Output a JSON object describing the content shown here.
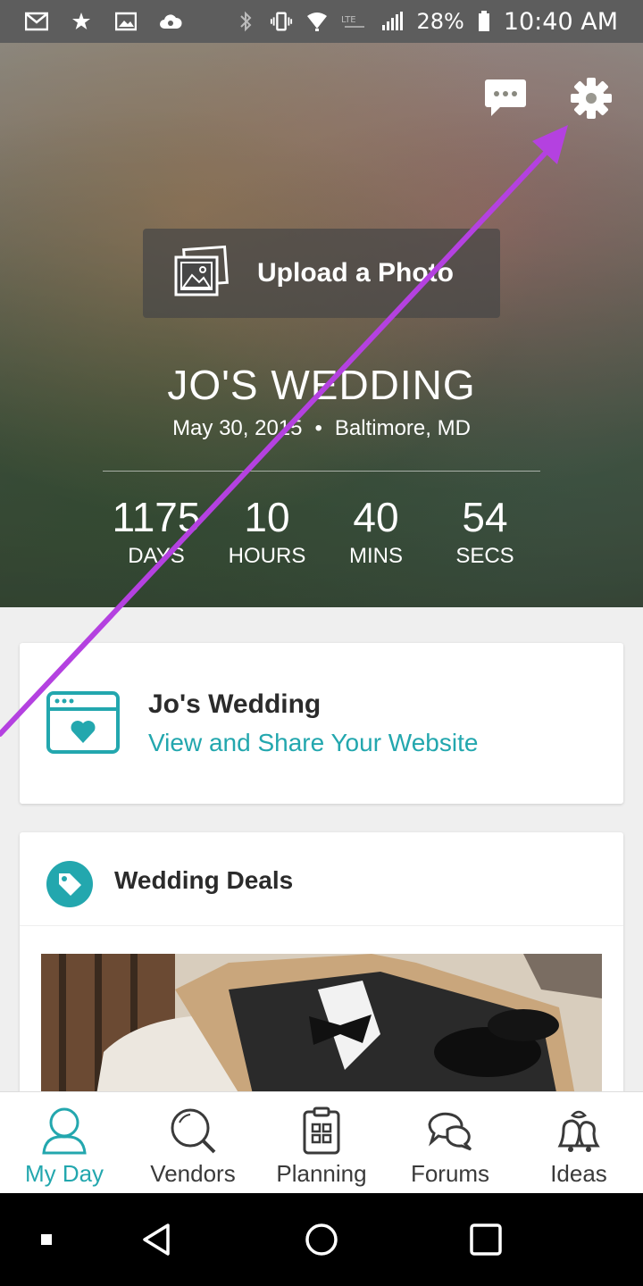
{
  "status_bar": {
    "battery": "28%",
    "time": "10:40 AM",
    "icons": [
      "gmail-icon",
      "star-icon",
      "image-icon",
      "cloud-icon",
      "bluetooth-icon",
      "vibrate-icon",
      "wifi-icon",
      "lte-icon",
      "signal-icon",
      "battery-icon"
    ]
  },
  "hero": {
    "upload_label": "Upload a Photo",
    "wedding_name": "JO'S WEDDING",
    "date": "May 30, 2015",
    "separator": "•",
    "location": "Baltimore, MD",
    "countdown": [
      {
        "value": "1175",
        "unit": "DAYS"
      },
      {
        "value": "10",
        "unit": "HOURS"
      },
      {
        "value": "40",
        "unit": "MINS"
      },
      {
        "value": "54",
        "unit": "SECS"
      }
    ]
  },
  "website_card": {
    "title": "Jo's Wedding",
    "link": "View and Share Your Website"
  },
  "deals_card": {
    "title": "Wedding Deals"
  },
  "bottom_nav": [
    {
      "label": "My Day",
      "icon": "person-icon",
      "active": true
    },
    {
      "label": "Vendors",
      "icon": "search-icon",
      "active": false
    },
    {
      "label": "Planning",
      "icon": "clipboard-icon",
      "active": false
    },
    {
      "label": "Forums",
      "icon": "chat-bubbles-icon",
      "active": false
    },
    {
      "label": "Ideas",
      "icon": "bells-icon",
      "active": false
    }
  ],
  "colors": {
    "accent": "#23a7ae",
    "annotation_arrow": "#b441e0",
    "status_bar": "#5d5d5d"
  }
}
